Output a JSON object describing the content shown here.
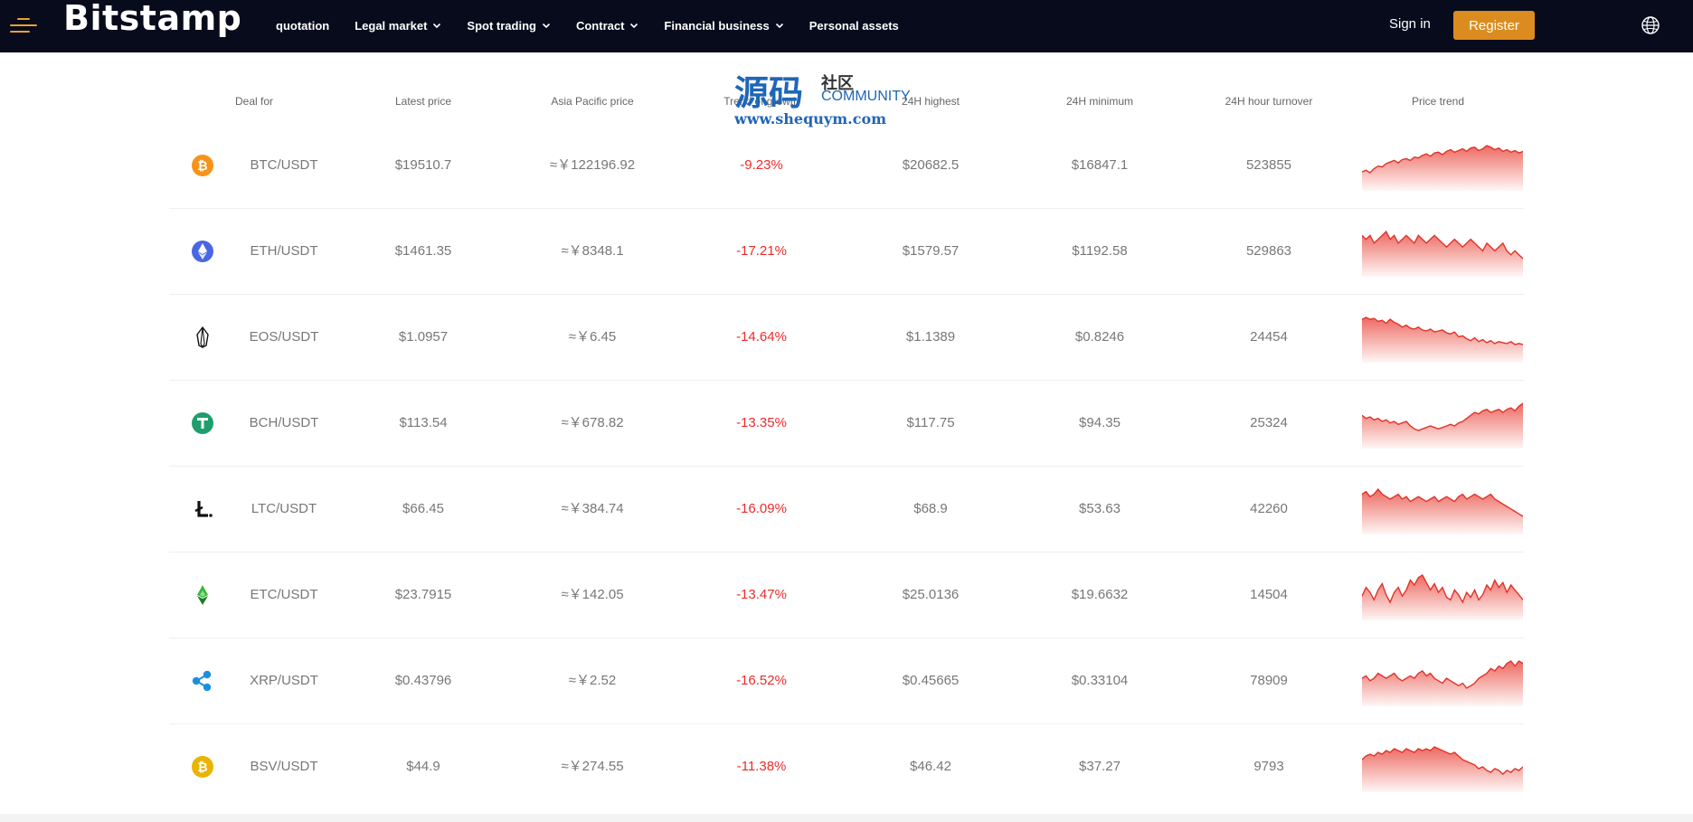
{
  "header": {
    "logo": "Bitstamp",
    "nav": [
      {
        "label": "quotation",
        "has_dropdown": false
      },
      {
        "label": "Legal market",
        "has_dropdown": true
      },
      {
        "label": "Spot trading",
        "has_dropdown": true
      },
      {
        "label": "Contract",
        "has_dropdown": true
      },
      {
        "label": "Financial business",
        "has_dropdown": true
      },
      {
        "label": "Personal assets",
        "has_dropdown": false
      }
    ],
    "sign_in": "Sign in",
    "register": "Register",
    "accent_color": "#dc8c1e"
  },
  "watermark": {
    "big": "源码",
    "small": "社区",
    "community": "COMMUNITY",
    "url": "www.shequym.com"
  },
  "table": {
    "columns": [
      "Deal for",
      "Latest price",
      "Asia Pacific price",
      "Trend of growth",
      "24H highest",
      "24H minimum",
      "24H hour turnover",
      "Price trend"
    ],
    "rows": [
      {
        "icon": "bitcoin-icon",
        "pair": "BTC/USDT",
        "latest": "$19510.7",
        "asia": "≈￥122196.92",
        "growth": "-9.23%",
        "high": "$20682.5",
        "low": "$16847.1",
        "turnover": "523855",
        "trend": [
          20,
          22,
          19,
          24,
          27,
          26,
          30,
          32,
          34,
          31,
          35,
          36,
          34,
          38,
          37,
          40,
          42,
          39,
          43,
          44,
          41,
          45,
          47,
          44,
          46,
          48,
          45,
          49,
          50,
          46,
          48,
          52,
          50,
          47,
          49,
          45,
          47,
          44,
          46,
          43,
          45
        ]
      },
      {
        "icon": "ethereum-icon",
        "pair": "ETH/USDT",
        "latest": "$1461.35",
        "asia": "≈￥8348.1",
        "growth": "-17.21%",
        "high": "$1579.57",
        "low": "$1192.58",
        "turnover": "529863",
        "trend": [
          50,
          49,
          50,
          48,
          49,
          50,
          51,
          49,
          50,
          48,
          49,
          50,
          49,
          48,
          50,
          49,
          48,
          49,
          50,
          49,
          48,
          47,
          48,
          49,
          48,
          47,
          48,
          49,
          48,
          47,
          46,
          48,
          47,
          46,
          47,
          48,
          46,
          45,
          46,
          45,
          44
        ]
      },
      {
        "icon": "eos-icon",
        "pair": "EOS/USDT",
        "latest": "$1.0957",
        "asia": "≈￥6.45",
        "growth": "-14.64%",
        "high": "$1.1389",
        "low": "$0.8246",
        "turnover": "24454",
        "trend": [
          42,
          44,
          42,
          43,
          40,
          41,
          38,
          42,
          39,
          37,
          34,
          36,
          33,
          32,
          34,
          31,
          30,
          32,
          29,
          30,
          31,
          28,
          27,
          29,
          24,
          25,
          22,
          20,
          23,
          19,
          21,
          18,
          20,
          17,
          19,
          18,
          17,
          19,
          16,
          17,
          16
        ]
      },
      {
        "icon": "tether-icon",
        "pair": "BCH/USDT",
        "latest": "$113.54",
        "asia": "≈￥678.82",
        "growth": "-13.35%",
        "high": "$117.75",
        "low": "$94.35",
        "turnover": "25324",
        "trend": [
          40,
          38,
          39,
          37,
          38,
          36,
          37,
          35,
          36,
          34,
          35,
          36,
          33,
          31,
          30,
          31,
          32,
          33,
          32,
          31,
          32,
          33,
          34,
          33,
          35,
          36,
          38,
          40,
          42,
          41,
          43,
          44,
          42,
          43,
          44,
          42,
          44,
          45,
          43,
          46,
          48
        ]
      },
      {
        "icon": "litecoin-icon",
        "pair": "LTC/USDT",
        "latest": "$66.45",
        "asia": "≈￥384.74",
        "growth": "-16.09%",
        "high": "$68.9",
        "low": "$53.63",
        "turnover": "42260",
        "trend": [
          45,
          46,
          44,
          45,
          47,
          45,
          44,
          43,
          44,
          45,
          43,
          44,
          42,
          43,
          44,
          43,
          42,
          43,
          44,
          42,
          43,
          44,
          43,
          42,
          44,
          45,
          43,
          44,
          45,
          44,
          43,
          44,
          45,
          43,
          42,
          41,
          40,
          39,
          38,
          37,
          36
        ]
      },
      {
        "icon": "ethereum-classic-icon",
        "pair": "ETC/USDT",
        "latest": "$23.7915",
        "asia": "≈￥142.05",
        "growth": "-13.47%",
        "high": "$25.0136",
        "low": "$19.6632",
        "turnover": "14504",
        "trend": [
          25,
          32,
          28,
          22,
          30,
          35,
          26,
          20,
          28,
          32,
          25,
          30,
          38,
          34,
          40,
          42,
          36,
          30,
          35,
          28,
          32,
          24,
          22,
          30,
          26,
          20,
          28,
          24,
          30,
          22,
          26,
          34,
          30,
          38,
          32,
          36,
          28,
          34,
          30,
          26,
          22
        ]
      },
      {
        "icon": "ripple-icon",
        "pair": "XRP/USDT",
        "latest": "$0.43796",
        "asia": "≈￥2.52",
        "growth": "-16.52%",
        "high": "$0.45665",
        "low": "$0.33104",
        "turnover": "78909",
        "trend": [
          40,
          41,
          39,
          40,
          42,
          41,
          40,
          41,
          42,
          40,
          39,
          40,
          41,
          40,
          42,
          43,
          41,
          42,
          40,
          39,
          38,
          40,
          39,
          38,
          37,
          38,
          36,
          37,
          38,
          40,
          41,
          42,
          44,
          43,
          45,
          44,
          46,
          47,
          45,
          47,
          46
        ]
      },
      {
        "icon": "bitcoin-sv-icon",
        "pair": "BSV/USDT",
        "latest": "$44.9",
        "asia": "≈￥274.55",
        "growth": "-11.38%",
        "high": "$46.42",
        "low": "$37.27",
        "turnover": "9793",
        "trend": [
          38,
          40,
          41,
          40,
          42,
          41,
          43,
          42,
          44,
          43,
          42,
          44,
          43,
          42,
          44,
          43,
          44,
          43,
          45,
          44,
          43,
          42,
          41,
          42,
          40,
          38,
          37,
          36,
          35,
          33,
          34,
          32,
          31,
          33,
          32,
          30,
          32,
          31,
          33,
          32,
          34
        ]
      }
    ]
  }
}
